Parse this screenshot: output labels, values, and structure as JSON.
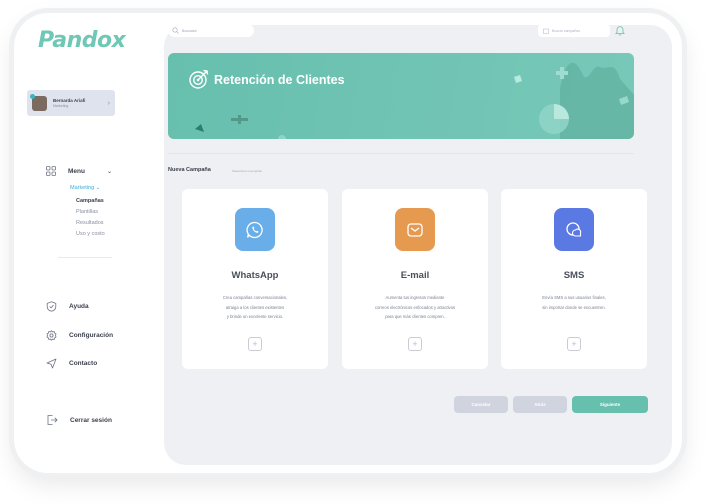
{
  "app": {
    "logo_text": "Pandox"
  },
  "user": {
    "name": "Bernarda Ariafi",
    "role": "Marketing"
  },
  "nav": {
    "menu_label": "Menu",
    "marketing_label": "Marketing",
    "sub_items": [
      "Campañas",
      "Plantillas",
      "Resultados",
      "Uso y costo"
    ],
    "help_label": "Ayuda",
    "settings_label": "Configuración",
    "contact_label": "Contacto",
    "logout_label": "Cerrar sesión"
  },
  "topbar": {
    "search_placeholder": "Buscador",
    "field_placeholder": "Buscar campañas"
  },
  "banner": {
    "title": "Retención de Clientes"
  },
  "section": {
    "title": "Nueva Campaña",
    "subtitle": "Seleccione una opción"
  },
  "cards": [
    {
      "title": "WhatsApp",
      "desc": [
        "Crea campañas conversacionales,",
        "atraiga a los clientes existentes",
        "y brinde un excelente servicio."
      ],
      "color": "#6aaee9"
    },
    {
      "title": "E-mail",
      "desc": [
        "Aumenta tus ingresos mediante",
        "correos electrónicos enfocados y atractivos",
        "para que más clientes compren."
      ],
      "color": "#e69a4f"
    },
    {
      "title": "SMS",
      "desc": [
        "Envía SMS a sus usuarios finales,",
        "sin importar donde se encuentren."
      ],
      "color": "#5b79e3"
    }
  ],
  "buttons": {
    "cancel_label": "Cancelar",
    "back_label": "Atrás",
    "next_label": "Siguiente"
  },
  "colors": {
    "accent": "#67bfae",
    "muted_button": "#d0d4df",
    "active_link": "#3ab0d8"
  }
}
